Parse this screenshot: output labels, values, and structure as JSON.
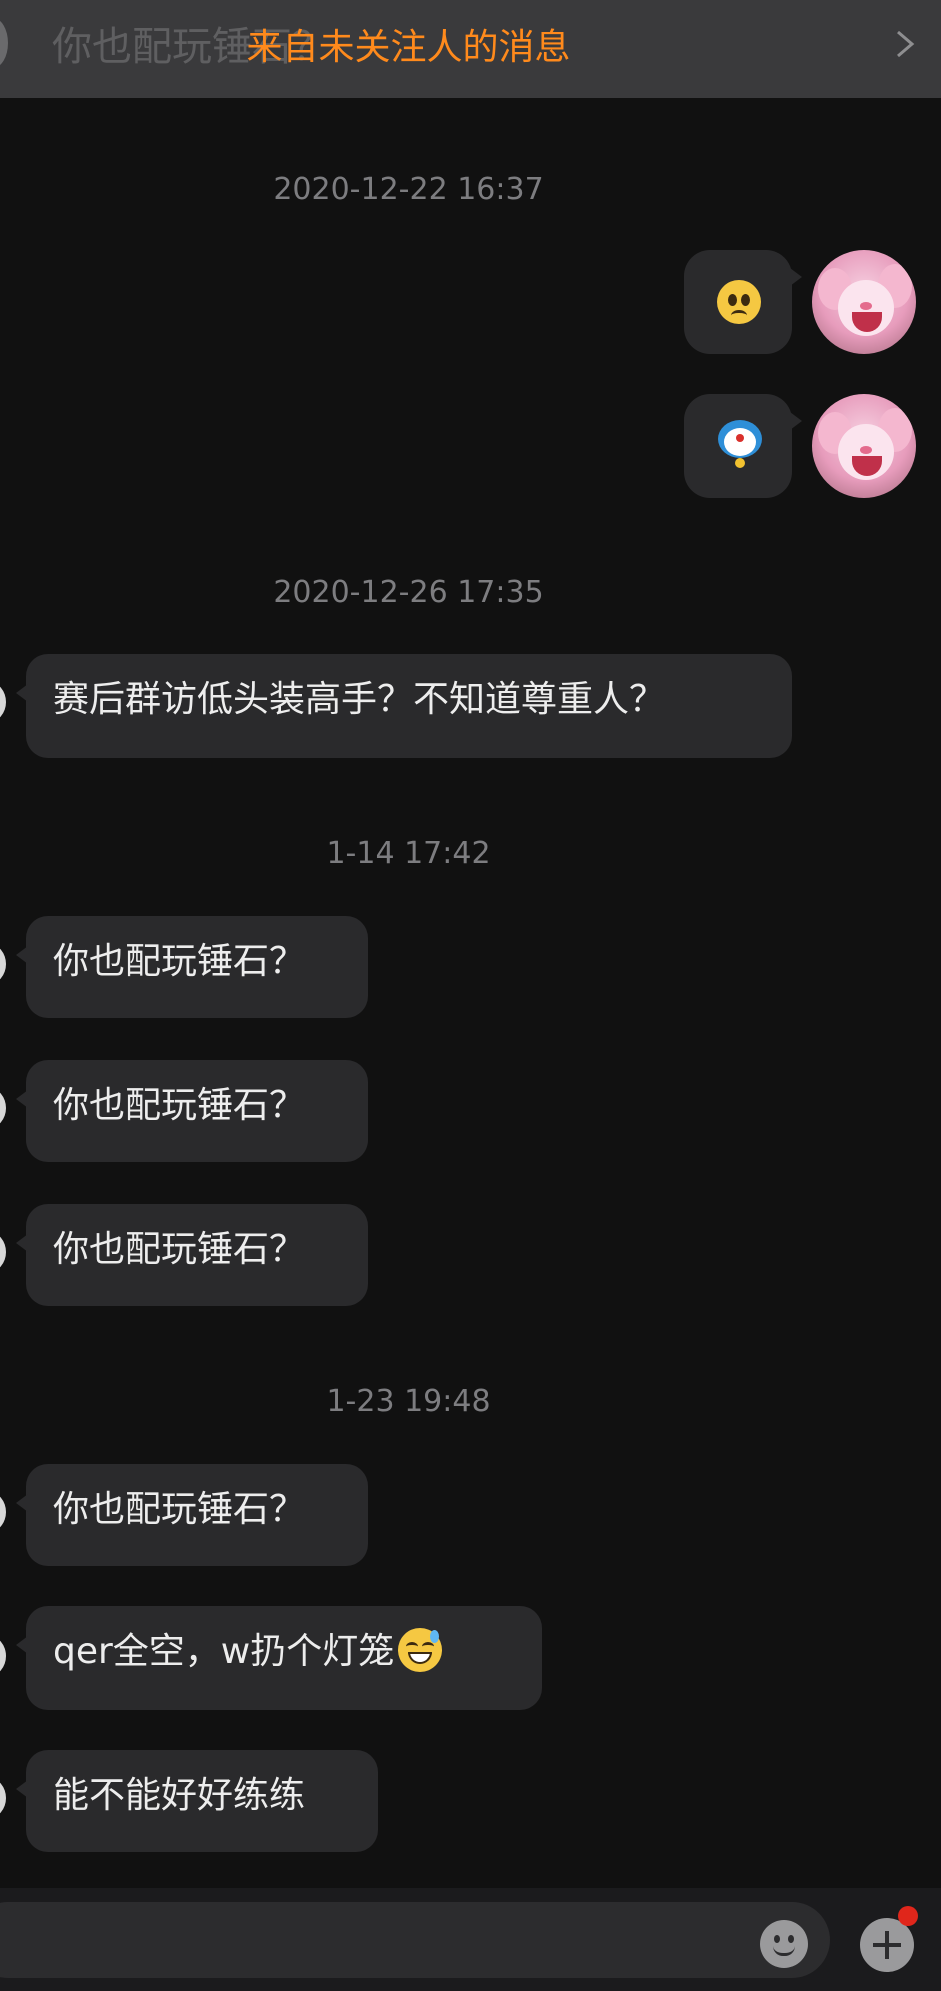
{
  "banner": {
    "title": "来自未关注人的消息",
    "preview": "你也配玩锤石？"
  },
  "timestamps": [
    "2020-12-22 16:37",
    "2020-12-26 17:35",
    "1-14 17:42",
    "1-23 19:48"
  ],
  "outgoing": [
    {
      "emoji": "sad-face-emoji"
    },
    {
      "emoji": "doraemon-emoji"
    }
  ],
  "incoming": [
    "赛后群访低头装高手？不知道尊重人？",
    "你也配玩锤石？",
    "你也配玩锤石？",
    "你也配玩锤石？",
    "你也配玩锤石？",
    "qer全空，w扔个灯笼",
    "能不能好好练练"
  ],
  "input": {
    "emoji_button_icon": "smiley-icon",
    "plus_button_icon": "plus-icon",
    "has_notification": true
  },
  "colors": {
    "background": "#111111",
    "banner_bg": "#3a3a3c",
    "banner_accent": "#ff8a1c",
    "bubble": "#2a2a2c",
    "timestamp": "#7d7d80",
    "notification": "#e0261b"
  }
}
